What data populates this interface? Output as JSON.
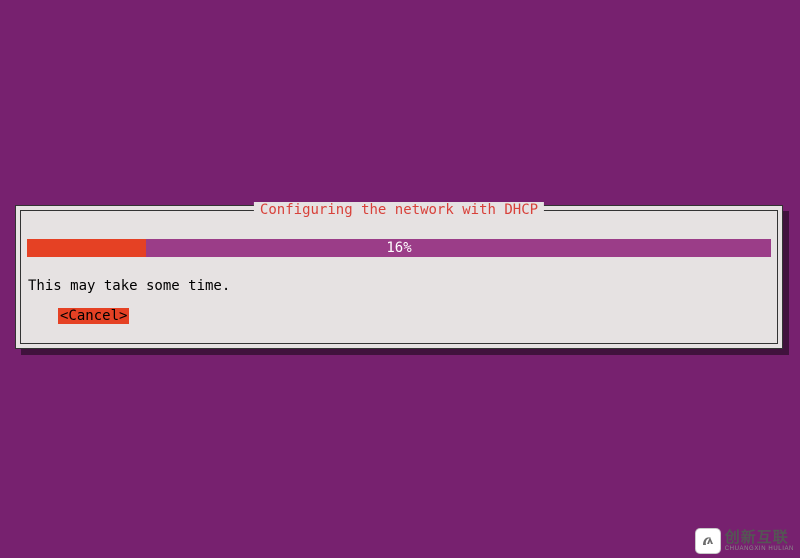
{
  "dialog": {
    "title": "Configuring the network with DHCP",
    "progress": {
      "percent": 16,
      "percent_text": "16%"
    },
    "message": "This may take some time.",
    "cancel_label": "<Cancel>"
  },
  "watermark": {
    "chinese": "创新互联",
    "english": "CHUANGXIN HULIAN",
    "logo_glyph": "α"
  },
  "colors": {
    "background": "#77216f",
    "progress_fill": "#e54124",
    "progress_track": "#9b3d88",
    "title_color": "#d8413a",
    "dialog_bg": "#e6e2e2"
  }
}
